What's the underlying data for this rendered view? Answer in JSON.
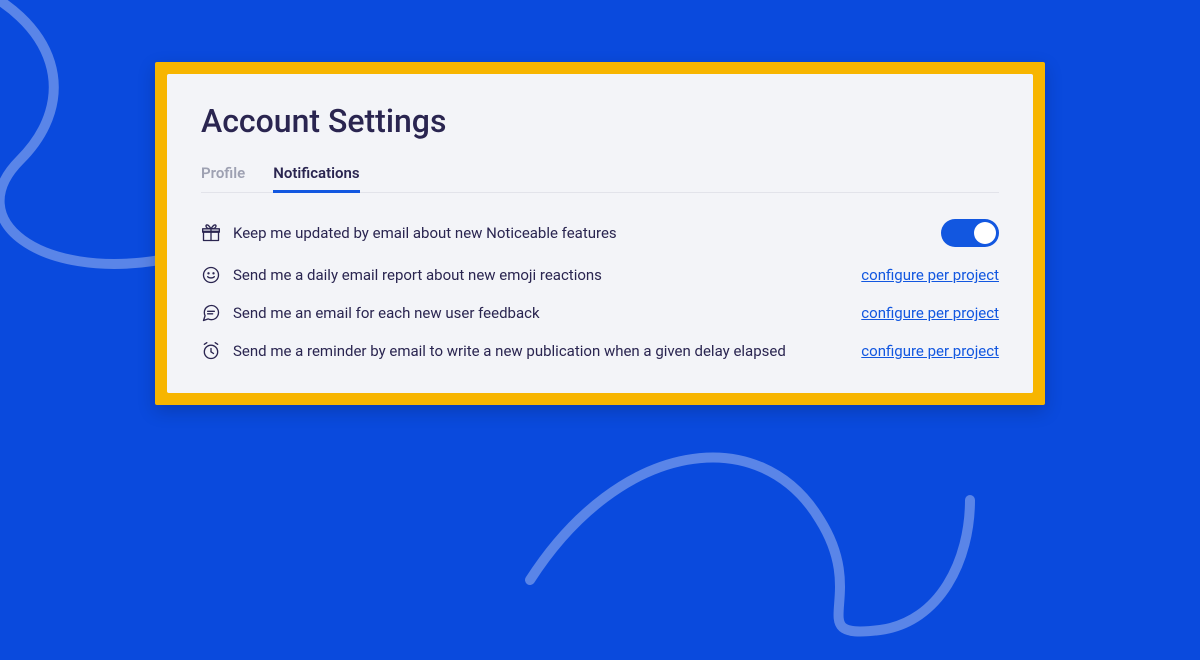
{
  "title": "Account Settings",
  "tabs": [
    {
      "label": "Profile",
      "active": false
    },
    {
      "label": "Notifications",
      "active": true
    }
  ],
  "configure_link_label": "configure per project",
  "rows": [
    {
      "icon": "gift-icon",
      "label": "Keep me updated by email about new Noticeable features",
      "control": "toggle",
      "toggle_on": true
    },
    {
      "icon": "smile-icon",
      "label": "Send me a daily email report about new emoji reactions",
      "control": "link"
    },
    {
      "icon": "chat-icon",
      "label": "Send me an email for each new user feedback",
      "control": "link"
    },
    {
      "icon": "alarm-icon",
      "label": "Send me a reminder by email to write a new publication when a given delay elapsed",
      "control": "link"
    }
  ]
}
